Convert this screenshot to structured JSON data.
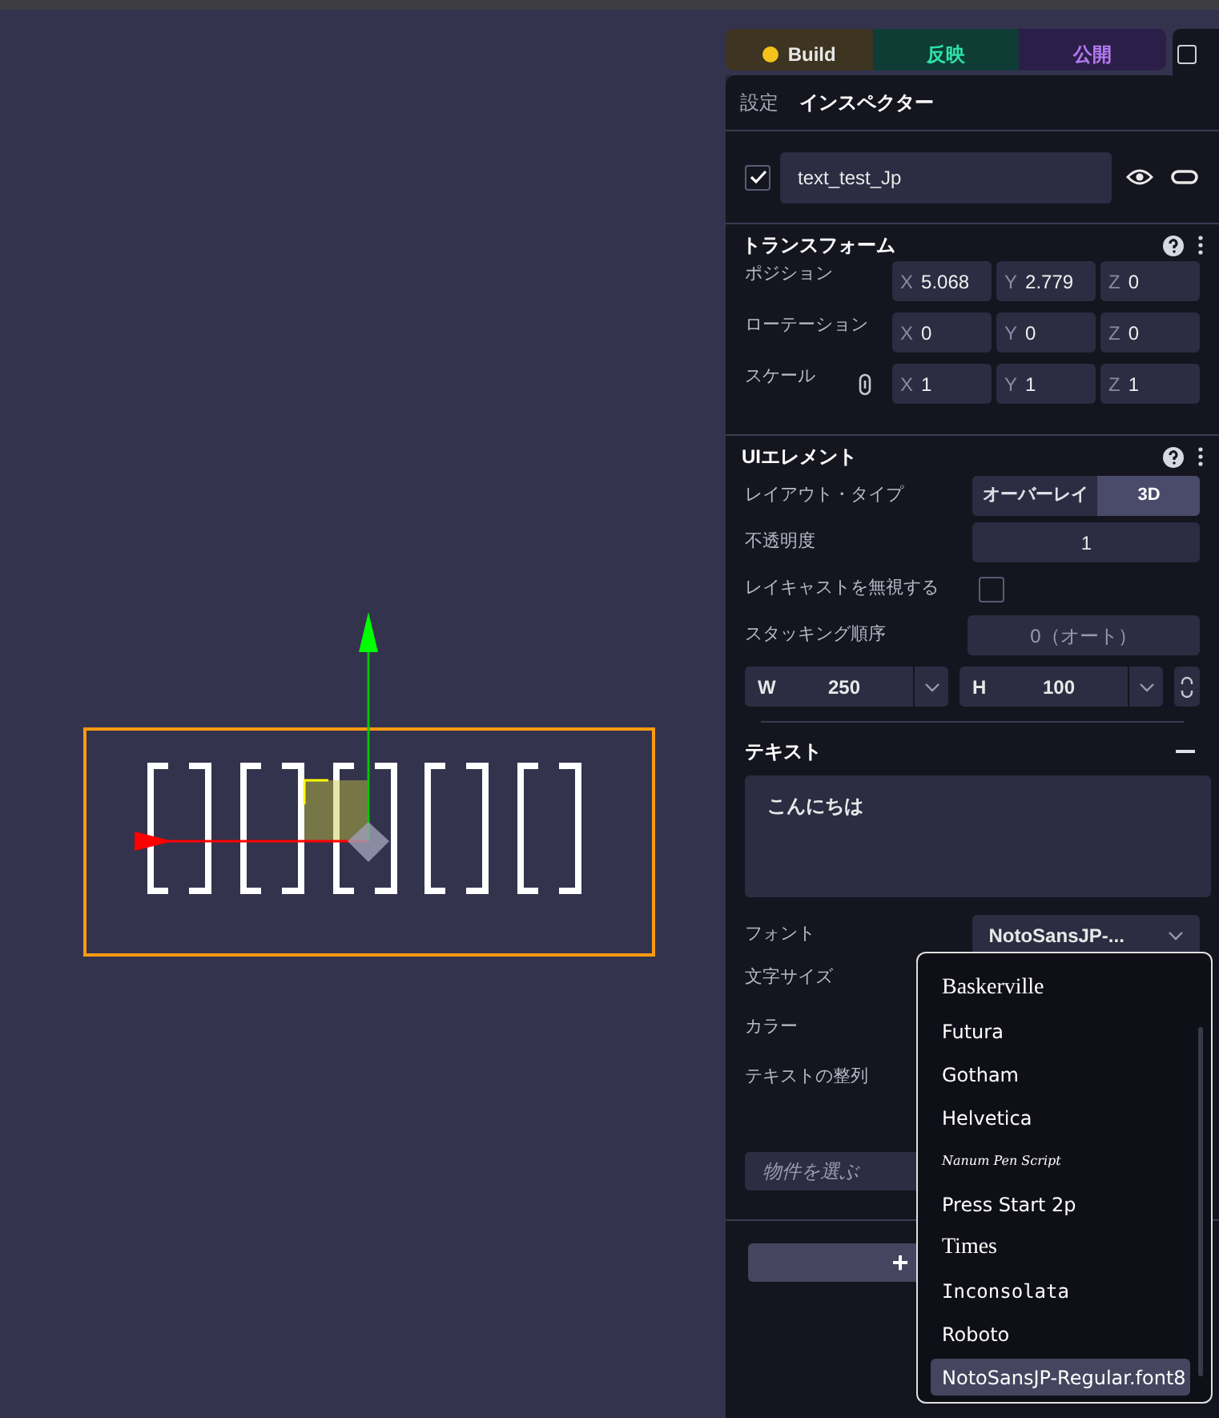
{
  "top_bar": {
    "buttons": [
      {
        "label": "Build",
        "kind": "build"
      },
      {
        "label": "反映",
        "kind": "reflect"
      },
      {
        "label": "公開",
        "kind": "publish"
      }
    ]
  },
  "inspector": {
    "tabs": [
      {
        "label": "設定",
        "selected": false
      },
      {
        "label": "インスペクター",
        "selected": true
      }
    ],
    "object": {
      "enabled": true,
      "name": "text_test_Jp"
    },
    "transform": {
      "title": "トランスフォーム",
      "rows": [
        {
          "label": "ポジション",
          "fields": [
            {
              "axis": "X",
              "value": "5.068"
            },
            {
              "axis": "Y",
              "value": "2.779"
            },
            {
              "axis": "Z",
              "value": "0"
            }
          ]
        },
        {
          "label": "ローテーション",
          "fields": [
            {
              "axis": "X",
              "value": "0"
            },
            {
              "axis": "Y",
              "value": "0"
            },
            {
              "axis": "Z",
              "value": "0"
            }
          ]
        },
        {
          "label": "スケール",
          "fields": [
            {
              "axis": "X",
              "value": "1"
            },
            {
              "axis": "Y",
              "value": "1"
            },
            {
              "axis": "Z",
              "value": "1"
            }
          ]
        }
      ]
    },
    "ui_element": {
      "title": "UIエレメント",
      "layout_type": {
        "label": "レイアウト・タイプ",
        "options": [
          {
            "label": "オーバーレイ",
            "selected": false
          },
          {
            "label": "3D",
            "selected": true
          }
        ]
      },
      "opacity": {
        "label": "不透明度",
        "value": "1"
      },
      "ignore_raycast": {
        "label": "レイキャストを無視する",
        "checked": false
      },
      "stacking": {
        "label": "スタッキング順序",
        "placeholder": "0（オート）"
      },
      "width": {
        "axis": "W",
        "value": "250"
      },
      "height": {
        "axis": "H",
        "value": "100"
      }
    },
    "text": {
      "title": "テキスト",
      "value": "こんにちは",
      "font_label": "フォント",
      "font_value": "NotoSansJP-...",
      "rows": [
        "文字サイズ",
        "カラー",
        "テキストの整列"
      ],
      "asset_placeholder": "物件を選ぶ",
      "add_label": "+"
    }
  },
  "font_dropdown": [
    {
      "label": "Baskerville",
      "kind": "serif",
      "selected": false
    },
    {
      "label": "Futura",
      "kind": "sans",
      "selected": false
    },
    {
      "label": "Gotham",
      "kind": "sans",
      "selected": false
    },
    {
      "label": "Helvetica",
      "kind": "sans",
      "selected": false
    },
    {
      "label": "Nanum Pen Script",
      "kind": "script",
      "selected": false
    },
    {
      "label": "Press Start 2p",
      "kind": "sans",
      "selected": false
    },
    {
      "label": "Times",
      "kind": "serif",
      "selected": false
    },
    {
      "label": "Inconsolata",
      "kind": "mono",
      "selected": false
    },
    {
      "label": "Roboto",
      "kind": "sans",
      "selected": false
    },
    {
      "label": "NotoSansJP-Regular.font8",
      "kind": "sans",
      "selected": true
    }
  ]
}
